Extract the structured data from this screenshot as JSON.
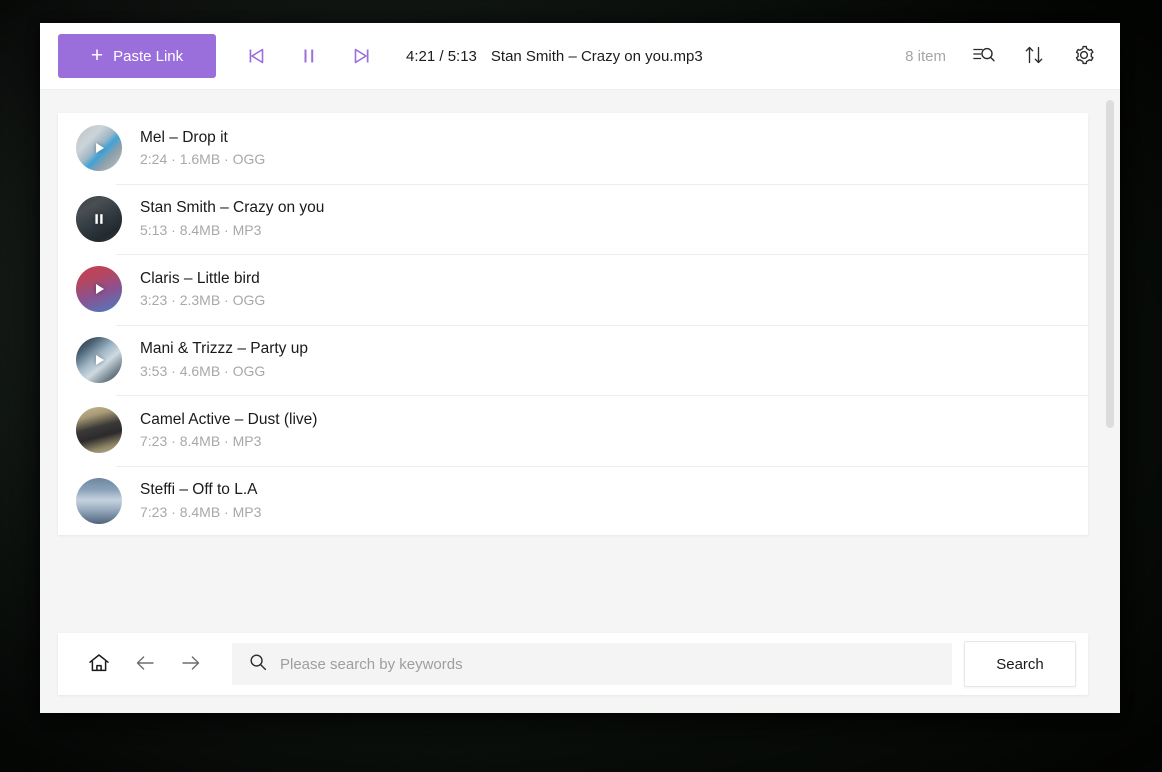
{
  "toolbar": {
    "paste_link_label": "Paste Link",
    "plus_glyph": "+",
    "prev_icon": "previous-track-icon",
    "playpause_icon": "pause-icon",
    "next_icon": "next-track-icon",
    "time_display": "4:21 / 5:13",
    "now_playing": "Stan Smith – Crazy on you.mp3",
    "item_count": "8 item",
    "filter_icon": "filter-search-icon",
    "sort_icon": "sort-icon",
    "settings_icon": "gear-icon",
    "accent_color": "#9b6fdb"
  },
  "tracks": [
    {
      "title": "Mel – Drop it",
      "meta": "2:24 · 1.6MB · OGG",
      "duration": "2:24",
      "size": "1.6MB",
      "format": "OGG",
      "state": "play",
      "art": "art-mel"
    },
    {
      "title": "Stan Smith – Crazy on you",
      "meta": "5:13 · 8.4MB · MP3",
      "duration": "5:13",
      "size": "8.4MB",
      "format": "MP3",
      "state": "pause",
      "art": "art-stan"
    },
    {
      "title": "Claris – Little bird",
      "meta": "3:23 · 2.3MB · OGG",
      "duration": "3:23",
      "size": "2.3MB",
      "format": "OGG",
      "state": "play",
      "art": "art-claris"
    },
    {
      "title": "Mani & Trizzz – Party up",
      "meta": "3:53 · 4.6MB · OGG",
      "duration": "3:53",
      "size": "4.6MB",
      "format": "OGG",
      "state": "play",
      "art": "art-mani"
    },
    {
      "title": "Camel Active – Dust (live)",
      "meta": "7:23 · 8.4MB · MP3",
      "duration": "7:23",
      "size": "8.4MB",
      "format": "MP3",
      "state": "none",
      "art": "art-camel"
    },
    {
      "title": "Steffi – Off to L.A",
      "meta": "7:23 · 8.4MB · MP3",
      "duration": "7:23",
      "size": "8.4MB",
      "format": "MP3",
      "state": "none",
      "art": "art-steffi"
    }
  ],
  "searchbar": {
    "home_icon": "home-icon",
    "back_icon": "back-arrow-icon",
    "forward_icon": "forward-arrow-icon",
    "search_icon": "search-icon",
    "placeholder": "Please search by keywords",
    "value": "",
    "search_button_label": "Search"
  }
}
